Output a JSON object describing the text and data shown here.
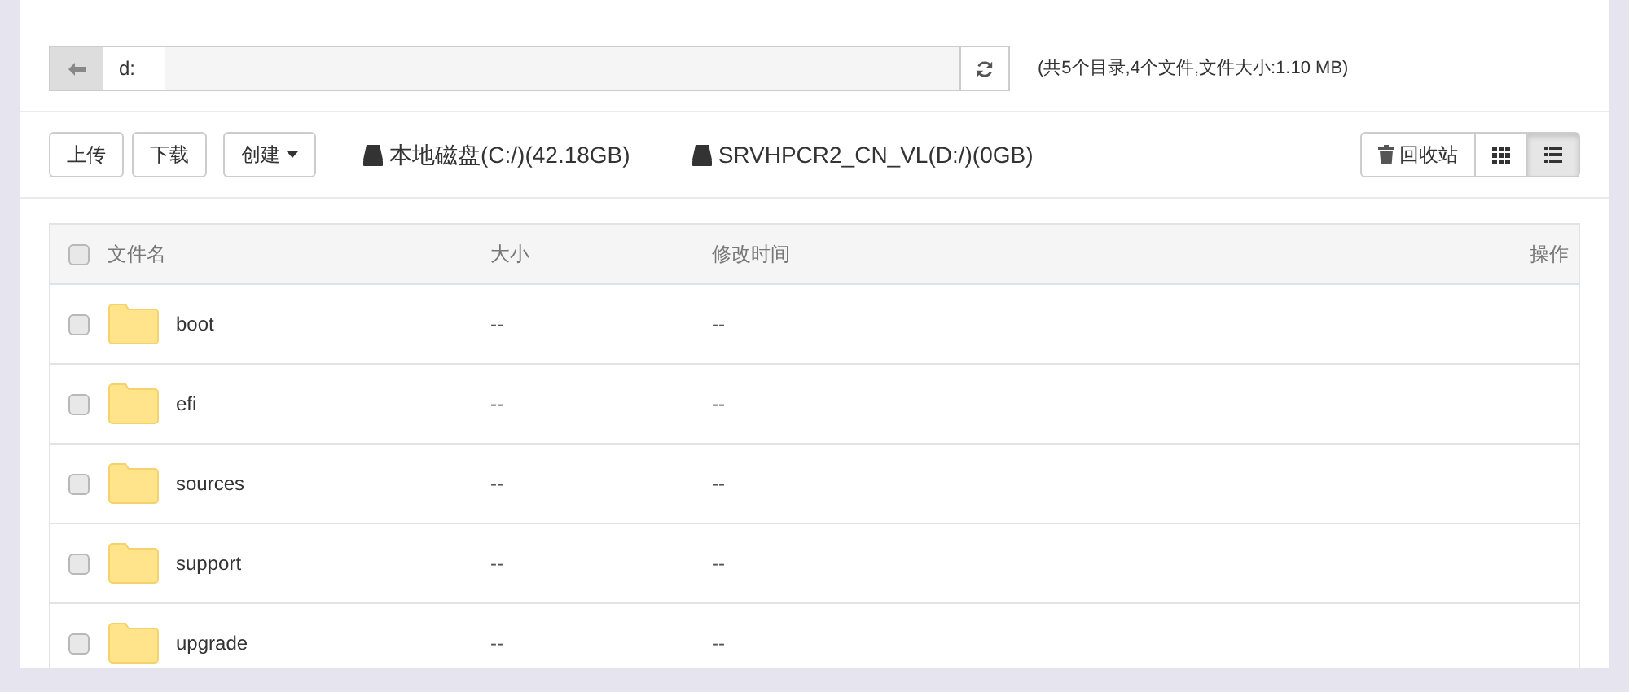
{
  "path_bar": {
    "segment": "d:",
    "summary": "(共5个目录,4个文件,文件大小:1.10 MB)"
  },
  "toolbar": {
    "buttons": [
      "上传",
      "下载"
    ],
    "create": "创建",
    "drives": [
      "本地磁盘(C:/)(42.18GB)",
      "SRVHPCR2_CN_VL(D:/)(0GB)"
    ],
    "recycle": "回收站",
    "views": [
      {
        "kind": "grid",
        "selected": false
      },
      {
        "kind": "list",
        "selected": true
      }
    ]
  },
  "table": {
    "select_all": {
      "checked": false
    },
    "columns": [
      "文件名",
      "大小",
      "修改时间",
      "操作"
    ],
    "rows": [
      {
        "name": "boot",
        "size": "--",
        "modified": "--",
        "checked": false
      },
      {
        "name": "efi",
        "size": "--",
        "modified": "--",
        "checked": false
      },
      {
        "name": "sources",
        "size": "--",
        "modified": "--",
        "checked": false
      },
      {
        "name": "support",
        "size": "--",
        "modified": "--",
        "checked": false
      },
      {
        "name": "upgrade",
        "size": "--",
        "modified": "--",
        "checked": false
      }
    ]
  }
}
